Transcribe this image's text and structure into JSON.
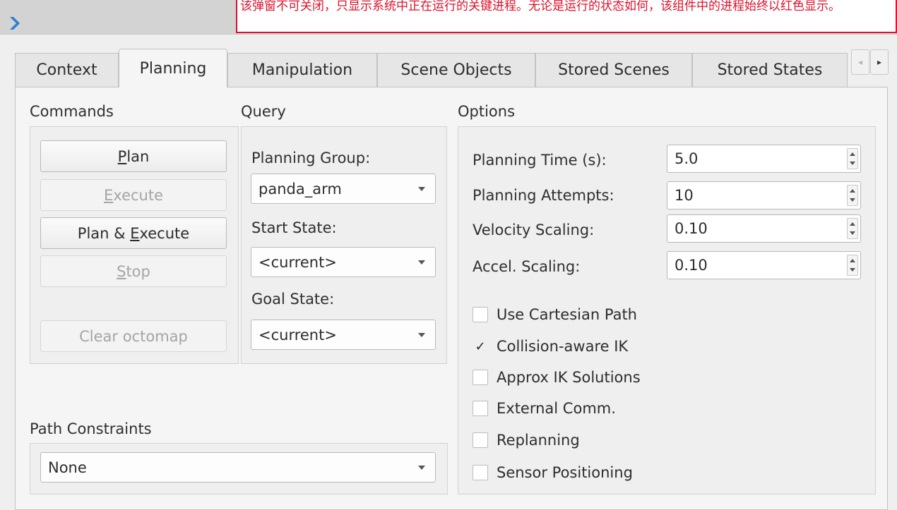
{
  "window": {
    "arrow_icon": "chevron-right-icon",
    "close_icon": "close-icon",
    "notice_text": "该弹窗不可关闭，只显示系统中正在运行的关键进程。无论是运行的状态如何，该组件中的进程始终以红色显示。"
  },
  "tabs": [
    {
      "label": "Context",
      "active": false
    },
    {
      "label": "Planning",
      "active": true
    },
    {
      "label": "Manipulation",
      "active": false
    },
    {
      "label": "Scene Objects",
      "active": false
    },
    {
      "label": "Stored Scenes",
      "active": false
    },
    {
      "label": "Stored States",
      "active": false
    }
  ],
  "tab_scroll": {
    "left": "◂",
    "right": "▸"
  },
  "commands": {
    "title": "Commands",
    "plan": {
      "pre": "",
      "u": "P",
      "post": "lan"
    },
    "execute": {
      "pre": "",
      "u": "E",
      "post": "xecute"
    },
    "plan_execute": {
      "pre": "Plan & ",
      "u": "E",
      "post": "xecute"
    },
    "stop": {
      "pre": "",
      "u": "S",
      "post": "top"
    },
    "clear_octomap": "Clear octomap"
  },
  "query": {
    "title": "Query",
    "planning_group_label": "Planning Group:",
    "planning_group_value": "panda_arm",
    "start_state_label": "Start State:",
    "start_state_value": "<current>",
    "goal_state_label": "Goal State:",
    "goal_state_value": "<current>"
  },
  "options": {
    "title": "Options",
    "planning_time_label": "Planning Time (s):",
    "planning_time_value": "5.0",
    "planning_attempts_label": "Planning Attempts:",
    "planning_attempts_value": "10",
    "velocity_scaling_label": "Velocity Scaling:",
    "velocity_scaling_value": "0.10",
    "accel_scaling_label": "Accel. Scaling:",
    "accel_scaling_value": "0.10",
    "checkboxes": [
      {
        "label": "Use Cartesian Path",
        "checked": false
      },
      {
        "label": "Collision-aware IK",
        "checked": true,
        "mark": "✓"
      },
      {
        "label": "Approx IK Solutions",
        "checked": false
      },
      {
        "label": "External Comm.",
        "checked": false
      },
      {
        "label": "Replanning",
        "checked": false
      },
      {
        "label": "Sensor Positioning",
        "checked": false
      }
    ]
  },
  "path_constraints": {
    "title": "Path Constraints",
    "value": "None"
  }
}
